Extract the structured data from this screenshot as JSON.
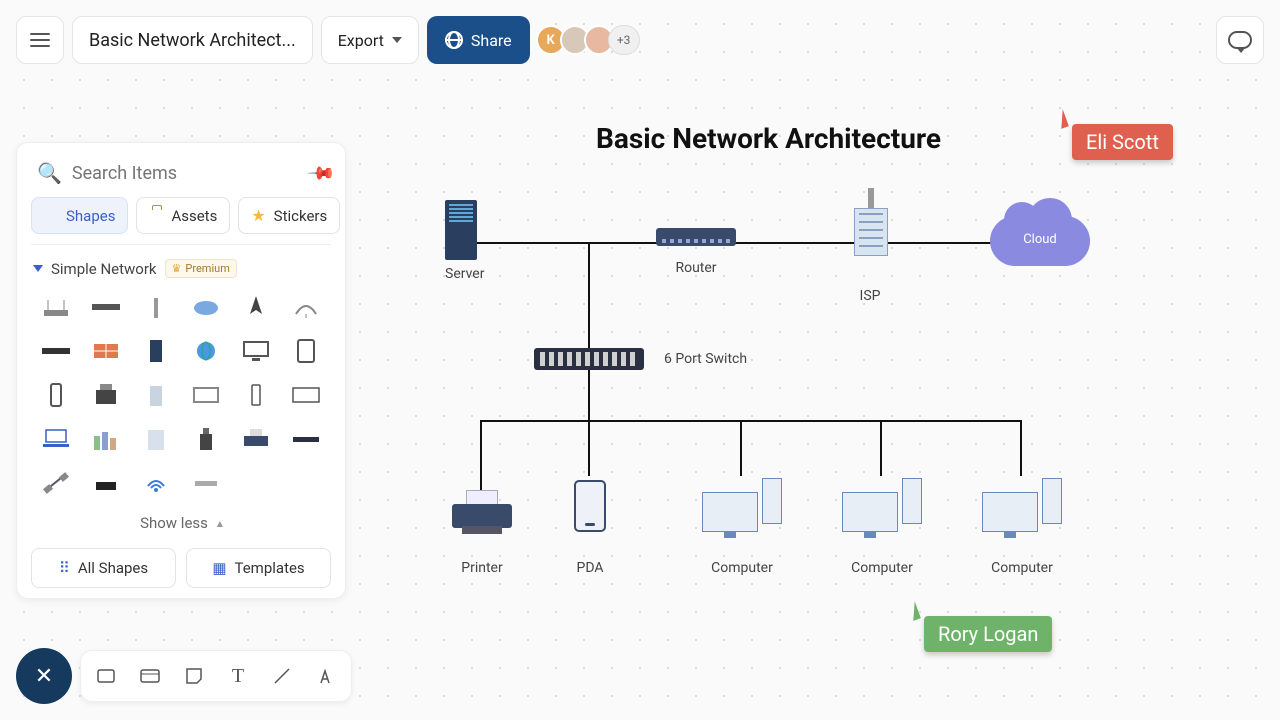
{
  "header": {
    "title": "Basic Network Architect...",
    "export": "Export",
    "share": "Share",
    "avatars": [
      {
        "initial": "K",
        "color": "#e8a85c"
      },
      {
        "initial": "",
        "color": "#d8c8b8"
      },
      {
        "initial": "",
        "color": "#e8b8a0"
      }
    ],
    "more_count": "+3"
  },
  "panel": {
    "search_placeholder": "Search Items",
    "tabs": {
      "shapes": "Shapes",
      "assets": "Assets",
      "stickers": "Stickers"
    },
    "section": {
      "title": "Simple Network",
      "premium": "Premium"
    },
    "show_less": "Show less",
    "all_shapes": "All Shapes",
    "templates": "Templates"
  },
  "diagram": {
    "title": "Basic Network Architecture",
    "labels": {
      "server": "Server",
      "router": "Router",
      "isp": "ISP",
      "cloud": "Cloud",
      "switch": "6 Port Switch",
      "printer": "Printer",
      "pda": "PDA",
      "computer": "Computer"
    }
  },
  "cursors": {
    "eli": "Eli Scott",
    "rory": "Rory Logan"
  }
}
